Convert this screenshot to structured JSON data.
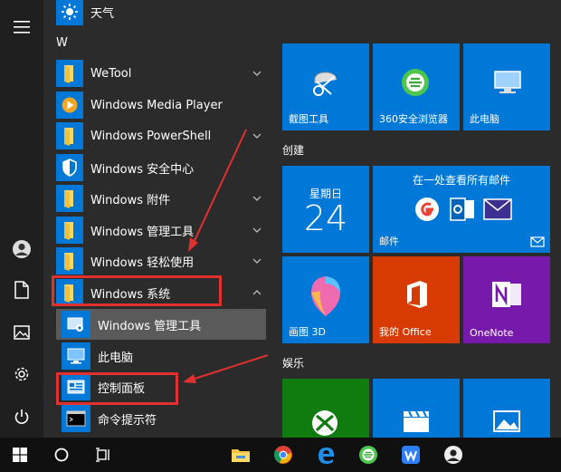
{
  "applist": {
    "top_item": {
      "label": "天气",
      "icon": "sun-icon"
    },
    "section_letter": "W",
    "items": [
      {
        "label": "WeTool",
        "icon": "folder-icon",
        "has_chevron": true
      },
      {
        "label": "Windows Media Player",
        "icon": "media-player-icon",
        "has_chevron": false
      },
      {
        "label": "Windows PowerShell",
        "icon": "folder-icon",
        "has_chevron": true
      },
      {
        "label": "Windows 安全中心",
        "icon": "shield-icon",
        "has_chevron": false
      },
      {
        "label": "Windows 附件",
        "icon": "folder-icon",
        "has_chevron": true
      },
      {
        "label": "Windows 管理工具",
        "icon": "folder-icon",
        "has_chevron": true
      },
      {
        "label": "Windows 轻松使用",
        "icon": "folder-icon",
        "has_chevron": true
      },
      {
        "label": "Windows 系统",
        "icon": "folder-icon",
        "has_chevron": true,
        "expanded": true
      }
    ],
    "subitems": [
      {
        "label": "Windows 管理工具",
        "icon": "admin-tools-icon",
        "hovered": true
      },
      {
        "label": "此电脑",
        "icon": "computer-icon"
      },
      {
        "label": "控制面板",
        "icon": "control-panel-icon"
      },
      {
        "label": "命令提示符",
        "icon": "cmd-icon"
      }
    ]
  },
  "tiles": {
    "row1": [
      {
        "label": "截图工具",
        "icon": "snipping-tool-icon"
      },
      {
        "label": "360安全浏览器",
        "icon": "browser-360-icon"
      },
      {
        "label": "此电脑",
        "icon": "computer-icon"
      }
    ],
    "group_create": "创建",
    "calendar": {
      "weekday": "星期日",
      "day": "24"
    },
    "mail": {
      "header": "在一处查看所有邮件",
      "label": "邮件"
    },
    "row3": [
      {
        "label": "画图 3D",
        "icon": "paint3d-icon"
      },
      {
        "label": "我的 Office",
        "icon": "office-icon"
      },
      {
        "label": "OneNote",
        "icon": "onenote-icon"
      }
    ],
    "group_entertainment": "娱乐"
  },
  "colors": {
    "tile_blue": "#0078d7",
    "office_orange": "#d83b01",
    "onenote_purple": "#7719aa",
    "xbox_green": "#107c10",
    "highlight_red": "#e0302f"
  },
  "taskbar_icons": [
    "windows-start-icon",
    "cortana-circle-icon",
    "task-view-icon",
    "file-explorer-icon",
    "chrome-icon",
    "edge-icon",
    "browser-360-icon",
    "wps-icon",
    "user-avatar-icon"
  ]
}
